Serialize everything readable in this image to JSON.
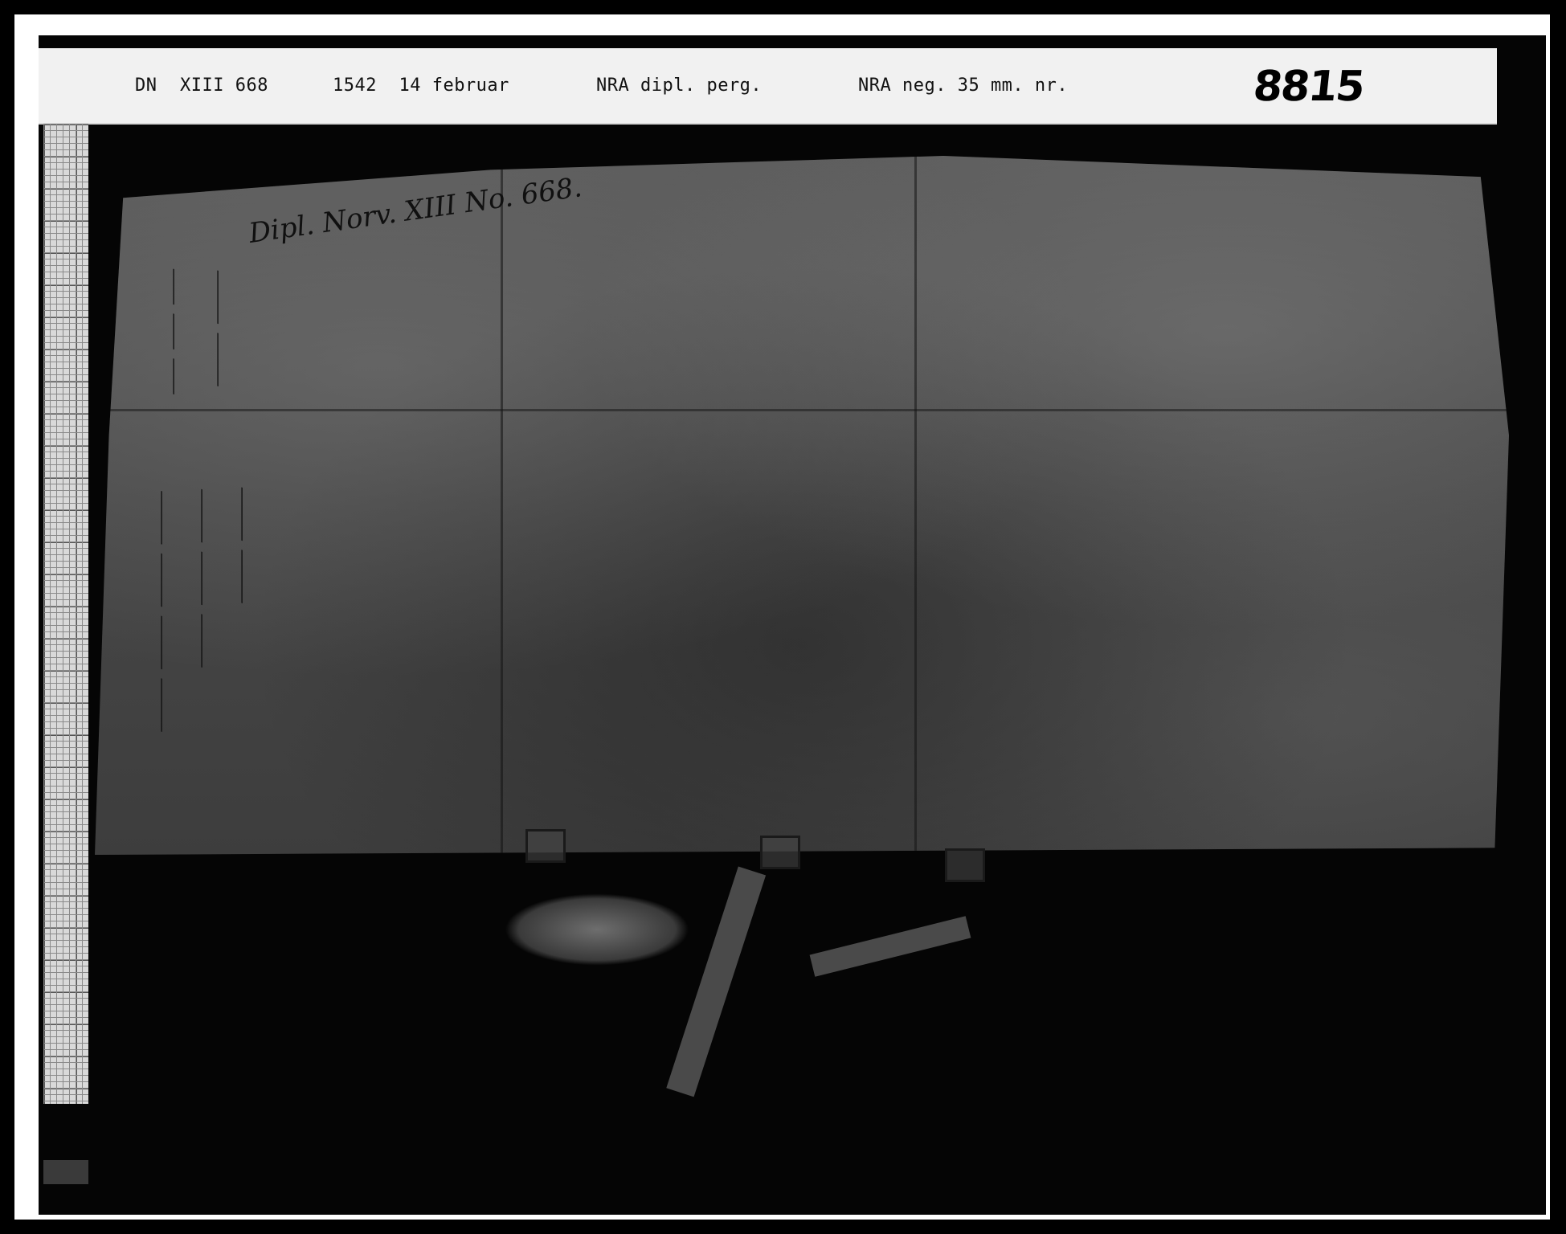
{
  "label": {
    "reference": "DN",
    "volume_number": "XIII 668",
    "date": "1542  14 februar",
    "collection": "NRA dipl. perg.",
    "negative": "NRA neg. 35 mm. nr.",
    "negative_number": "8815"
  },
  "document": {
    "dorsal_note": "Dipl. Norv. XIII No. 668."
  }
}
